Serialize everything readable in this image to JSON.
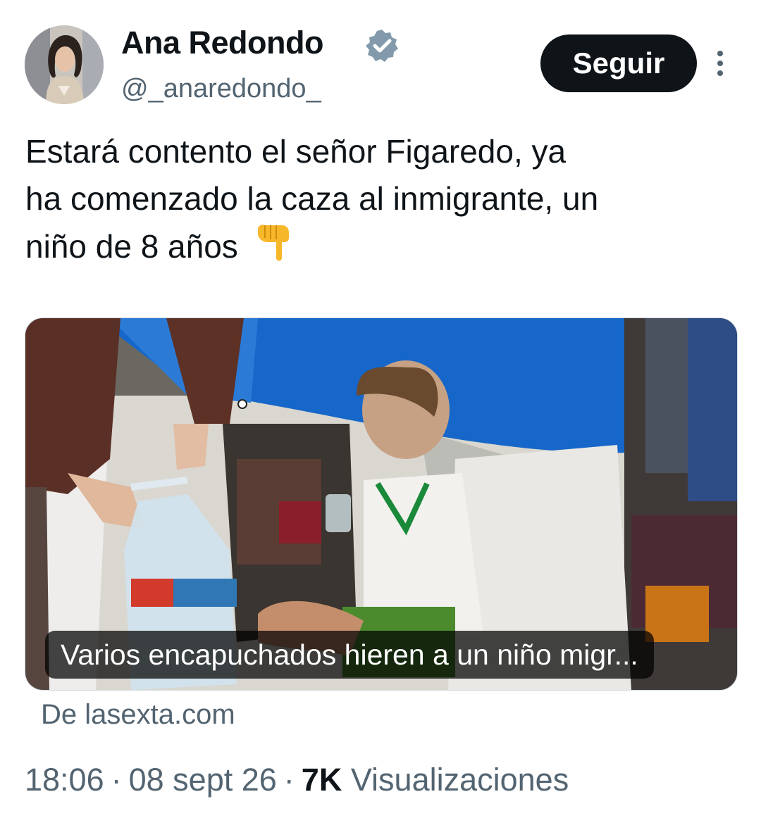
{
  "author": {
    "name": "Ana Redondo",
    "handle": "@_anaredondo_",
    "verified": true,
    "avatar_icon": "user-avatar-photo"
  },
  "actions": {
    "follow_label": "Seguir",
    "more_icon": "more-vertical-icon"
  },
  "tweet": {
    "lines": [
      "Estará contento el señor Figaredo, ya",
      "ha comenzado la caza al inmigrante, un",
      "niño de 8 años"
    ],
    "emoji": "backhand-index-pointing-down"
  },
  "media": {
    "caption": "Varios encapuchados hieren a un niño migr...",
    "source": "De lasexta.com"
  },
  "meta": {
    "time": "18:06",
    "separator": "·",
    "date": "08 sept 26",
    "views_count": "7K",
    "views_label": "Visualizaciones"
  },
  "colors": {
    "text": "#0f1419",
    "secondary": "#536471",
    "verified": "#829aab",
    "button_bg": "#0f1419"
  }
}
